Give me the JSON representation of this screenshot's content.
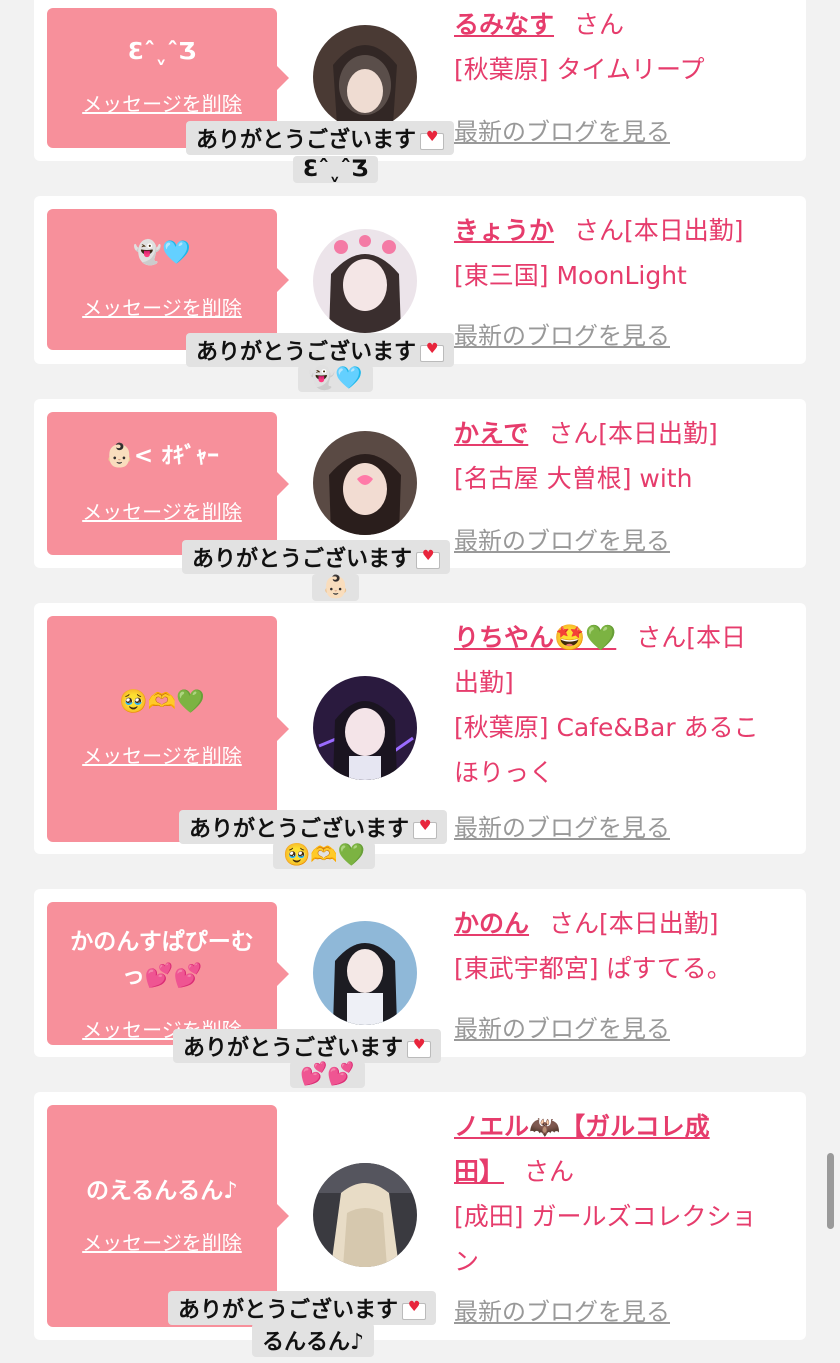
{
  "honorific": "さん",
  "delete_label": "メッセージを削除",
  "blog_label": "最新のブログを見る",
  "thanks_text": "ありがとうございます",
  "cards": [
    {
      "message": "ƐˆˬˆƷ",
      "name": "るみなす",
      "status": "",
      "shop_line1": "[秋葉原] タイムリープ",
      "shop_line2": "",
      "notif_sub": "ƐˆˬˆƷ"
    },
    {
      "message": "👻🩵",
      "name": "きょうか",
      "status": "[本日出勤]",
      "shop_line1": "[東三国] MoonLight",
      "shop_line2": "",
      "notif_sub": "👻🩵"
    },
    {
      "message": "👶🏻< ｵｷﾞｬｰ",
      "name": "かえで",
      "status": "[本日出勤]",
      "shop_line1": "[名古屋 大曽根] with",
      "shop_line2": "",
      "notif_sub": "👶🏻"
    },
    {
      "message": "🥹🫶💚",
      "name": "りちやん🤩💚",
      "status": "[本日",
      "status_line2": "出勤]",
      "shop_line1": "[秋葉原] Cafe&Bar あるこ",
      "shop_line2": "ほりっく",
      "notif_sub": "🥹🫶💚"
    },
    {
      "message": "かのんすぱぴーむ",
      "message_line2": "っ💕💕",
      "name": "かのん",
      "status": "[本日出勤]",
      "shop_line1": "[東武宇都宮] ぱすてる。",
      "shop_line2": "",
      "notif_sub": "💕💕"
    },
    {
      "message": "のえるんるん♪",
      "name": "ノエル🦇【ガルコレ成",
      "name_line2": "田】",
      "status": "",
      "shop_line1": "[成田] ガールズコレクショ",
      "shop_line2": "ン",
      "notif_sub": "るんるん♪"
    }
  ]
}
